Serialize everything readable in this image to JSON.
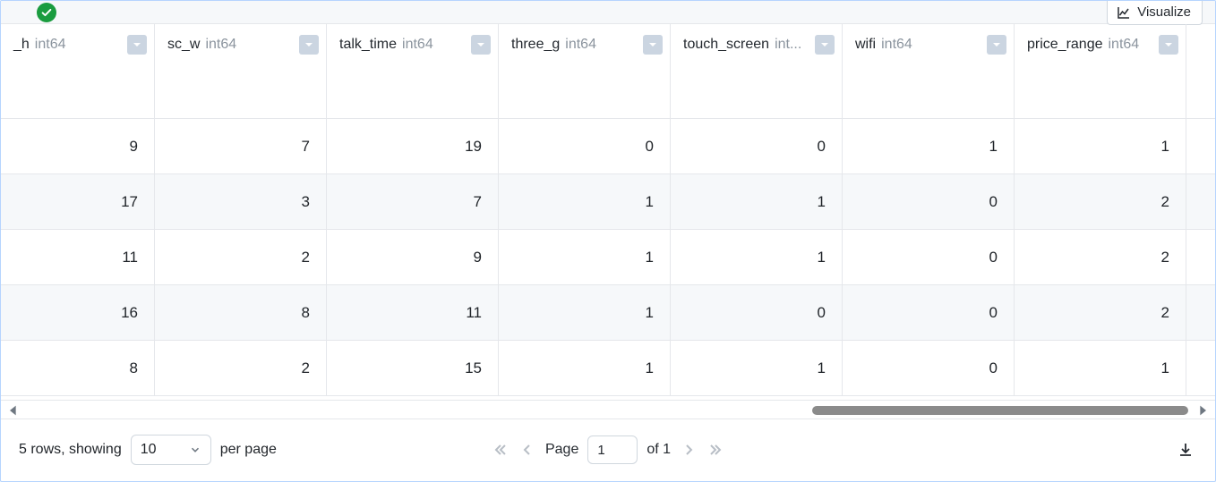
{
  "buttons": {
    "visualize": "Visualize"
  },
  "table": {
    "columns": [
      {
        "name": "_h",
        "type": "int64"
      },
      {
        "name": "sc_w",
        "type": "int64"
      },
      {
        "name": "talk_time",
        "type": "int64"
      },
      {
        "name": "three_g",
        "type": "int64"
      },
      {
        "name": "touch_screen",
        "type": "int..."
      },
      {
        "name": "wifi",
        "type": "int64"
      },
      {
        "name": "price_range",
        "type": "int64"
      }
    ],
    "rows": [
      [
        9,
        7,
        19,
        0,
        0,
        1,
        1
      ],
      [
        17,
        3,
        7,
        1,
        1,
        0,
        2
      ],
      [
        11,
        2,
        9,
        1,
        1,
        0,
        2
      ],
      [
        16,
        8,
        11,
        1,
        0,
        0,
        2
      ],
      [
        8,
        2,
        15,
        1,
        1,
        0,
        1
      ]
    ]
  },
  "footer": {
    "rows_text_prefix": "5 rows, showing",
    "per_page_value": "10",
    "per_page_suffix": "per page",
    "page_label": "Page",
    "page_current": "1",
    "page_of": "of 1"
  }
}
